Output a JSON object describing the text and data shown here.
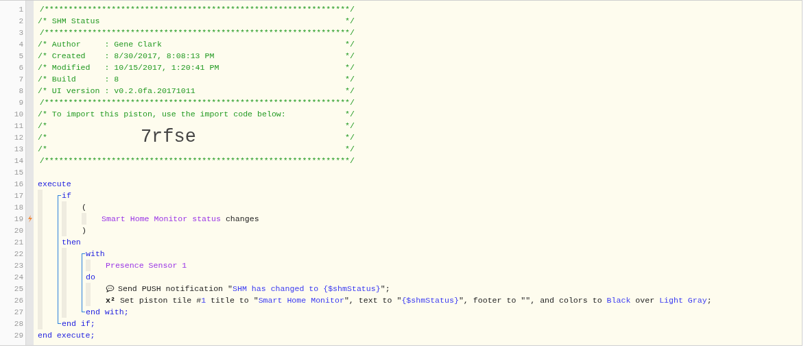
{
  "editor": {
    "lines": [
      {
        "number": "1",
        "box": true,
        "tokens": [
          {
            "text": "/****************************************************************/",
            "kind": "comment"
          }
        ]
      },
      {
        "number": "2",
        "box": true,
        "tokens": [
          {
            "text": "/* SHM Status",
            "kind": "comment"
          },
          {
            "text": "*/",
            "kind": "comment"
          }
        ]
      },
      {
        "number": "3",
        "box": true,
        "tokens": [
          {
            "text": "/****************************************************************/",
            "kind": "comment"
          }
        ]
      },
      {
        "number": "4",
        "box": true,
        "tokens": [
          {
            "text": "/* Author     : Gene Clark",
            "kind": "comment"
          },
          {
            "text": "*/",
            "kind": "comment"
          }
        ]
      },
      {
        "number": "5",
        "box": true,
        "tokens": [
          {
            "text": "/* Created    : 8/30/2017, 8:08:13 PM",
            "kind": "comment"
          },
          {
            "text": "*/",
            "kind": "comment"
          }
        ]
      },
      {
        "number": "6",
        "box": true,
        "tokens": [
          {
            "text": "/* Modified   : 10/15/2017, 1:20:41 PM",
            "kind": "comment"
          },
          {
            "text": "*/",
            "kind": "comment"
          }
        ]
      },
      {
        "number": "7",
        "box": true,
        "tokens": [
          {
            "text": "/* Build      : 8",
            "kind": "comment"
          },
          {
            "text": "*/",
            "kind": "comment"
          }
        ]
      },
      {
        "number": "8",
        "box": true,
        "tokens": [
          {
            "text": "/* UI version : v0.2.0fa.20171011",
            "kind": "comment"
          },
          {
            "text": "*/",
            "kind": "comment"
          }
        ]
      },
      {
        "number": "9",
        "box": true,
        "tokens": [
          {
            "text": "/****************************************************************/",
            "kind": "comment"
          }
        ]
      },
      {
        "number": "10",
        "box": true,
        "tokens": [
          {
            "text": "/* To import this piston, use the import code below:",
            "kind": "comment"
          },
          {
            "text": "*/",
            "kind": "comment"
          }
        ]
      },
      {
        "number": "11",
        "box": true,
        "tokens": [
          {
            "text": "/*",
            "kind": "comment"
          },
          {
            "text": "*/",
            "kind": "comment"
          }
        ]
      },
      {
        "number": "12",
        "box": true,
        "tokens": [
          {
            "text": "/*",
            "kind": "comment"
          },
          {
            "text": "7rfse",
            "kind": "big"
          },
          {
            "text": "*/",
            "kind": "comment"
          }
        ]
      },
      {
        "number": "13",
        "box": true,
        "tokens": [
          {
            "text": "/*",
            "kind": "comment"
          },
          {
            "text": "*/",
            "kind": "comment"
          }
        ]
      },
      {
        "number": "14",
        "box": true,
        "tokens": [
          {
            "text": "/****************************************************************/",
            "kind": "comment"
          }
        ]
      },
      {
        "number": "15"
      },
      {
        "number": "16",
        "tokens": [
          {
            "text": "execute",
            "kind": "keyword"
          }
        ],
        "children": [
          {
            "kind": "bracket",
            "children": [
              {
                "number": "17",
                "tokens": [
                  {
                    "text": "if",
                    "kind": "keyword"
                  }
                ],
                "children": [
                  {
                    "number": "18",
                    "tokens": [
                      {
                        "text": "(",
                        "kind": "plain"
                      }
                    ],
                    "children": [
                      {
                        "number": "19",
                        "trigger": true,
                        "tokens": [
                          {
                            "text": "Smart Home Monitor status",
                            "kind": "device"
                          },
                          {
                            "text": " changes",
                            "kind": "plain"
                          }
                        ]
                      }
                    ]
                  },
                  {
                    "number": "20",
                    "tokens": [
                      {
                        "text": ")",
                        "kind": "plain"
                      }
                    ]
                  }
                ]
              },
              {
                "number": "21",
                "tokens": [
                  {
                    "text": "then",
                    "kind": "keyword"
                  }
                ],
                "children": [
                  {
                    "kind": "bracket",
                    "children": [
                      {
                        "number": "22",
                        "tokens": [
                          {
                            "text": "with",
                            "kind": "keyword"
                          }
                        ],
                        "children": [
                          {
                            "number": "23",
                            "tokens": [
                              {
                                "text": "Presence Sensor 1",
                                "kind": "device"
                              }
                            ]
                          }
                        ]
                      },
                      {
                        "number": "24",
                        "tokens": [
                          {
                            "text": "do",
                            "kind": "keyword"
                          }
                        ],
                        "children": [
                          {
                            "number": "25",
                            "tokens": [
                              {
                                "kind": "chat-icon"
                              },
                              {
                                "text": "Send PUSH notification \"",
                                "kind": "plain"
                              },
                              {
                                "text": "SHM has changed to {$shmStatus}",
                                "kind": "string"
                              },
                              {
                                "text": "\";",
                                "kind": "plain"
                              }
                            ]
                          },
                          {
                            "number": "26",
                            "tokens": [
                              {
                                "text": "x²",
                                "kind": "symbol"
                              },
                              {
                                "text": " Set piston tile #",
                                "kind": "plain"
                              },
                              {
                                "text": "1",
                                "kind": "string"
                              },
                              {
                                "text": " title to \"",
                                "kind": "plain"
                              },
                              {
                                "text": "Smart Home Monitor",
                                "kind": "string"
                              },
                              {
                                "text": "\", text to \"",
                                "kind": "plain"
                              },
                              {
                                "text": "{$shmStatus}",
                                "kind": "string"
                              },
                              {
                                "text": "\", footer to \"\", and colors to ",
                                "kind": "plain"
                              },
                              {
                                "text": "Black",
                                "kind": "string"
                              },
                              {
                                "text": " over ",
                                "kind": "plain"
                              },
                              {
                                "text": "Light Gray",
                                "kind": "string"
                              },
                              {
                                "text": ";",
                                "kind": "plain"
                              }
                            ]
                          }
                        ]
                      },
                      {
                        "number": "27",
                        "tokens": [
                          {
                            "text": "end with;",
                            "kind": "keyword"
                          }
                        ]
                      }
                    ]
                  }
                ]
              },
              {
                "number": "28",
                "tokens": [
                  {
                    "text": "end if;",
                    "kind": "keyword"
                  }
                ]
              }
            ]
          }
        ]
      },
      {
        "number": "29",
        "tokens": [
          {
            "text": "end execute;",
            "kind": "keyword"
          }
        ]
      }
    ]
  }
}
